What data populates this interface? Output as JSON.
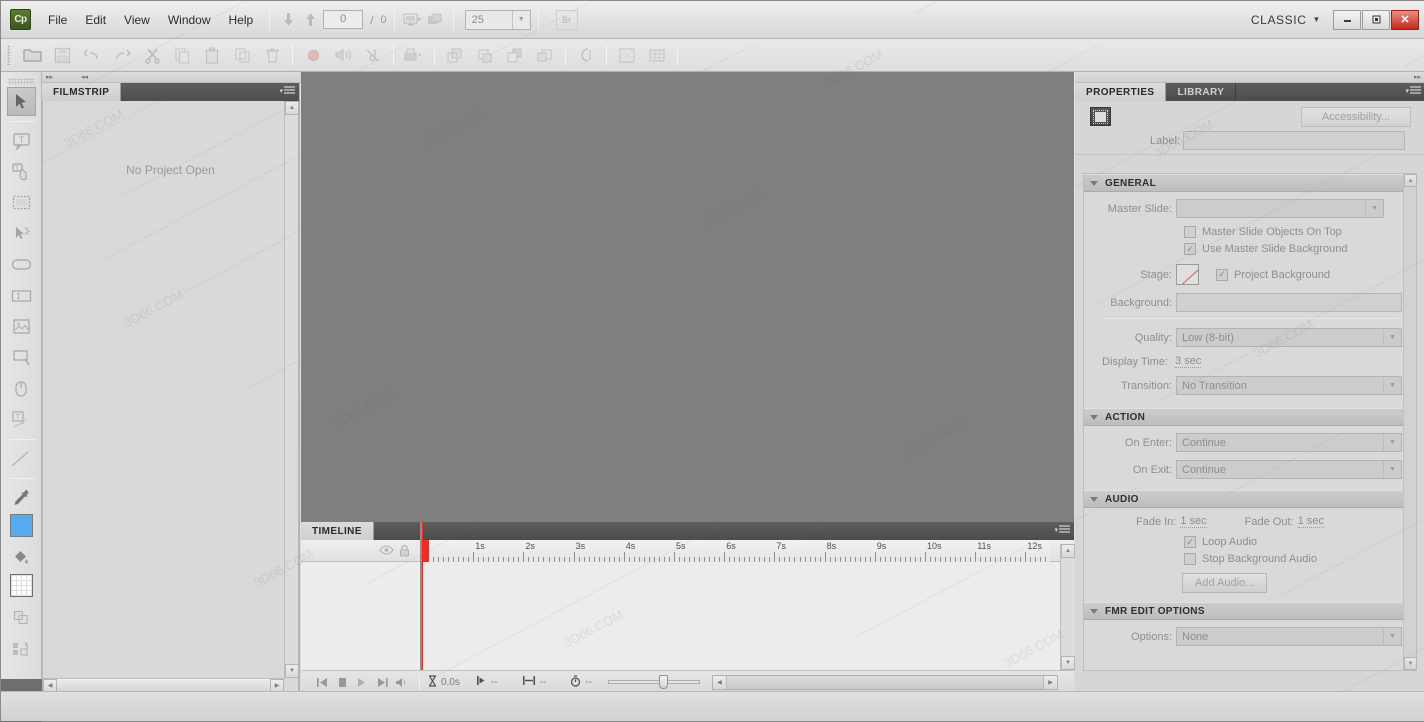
{
  "app": {
    "name": "Adobe Captivate",
    "logo_text": "Cp"
  },
  "menubar": {
    "items": [
      "File",
      "Edit",
      "View",
      "Window",
      "Help"
    ],
    "slide_nav": {
      "prev_icon": "arrow-down-icon",
      "next_icon": "arrow-up-icon",
      "current_slide": "0",
      "separator": "/",
      "total_slides": "0"
    },
    "preview_icon": "preview-monitor-icon",
    "publish_icon": "publish-icon",
    "zoom": {
      "value": "25",
      "caret": "▼"
    },
    "bridge_button": "Br",
    "workspace": {
      "label": "CLASSIC",
      "caret": "▼"
    },
    "window_controls": {
      "minimize": "—",
      "restore": "❐",
      "close": "✕"
    }
  },
  "toolbar": {
    "groups": [
      [
        "open-icon",
        "save-icon",
        "undo-icon",
        "redo-icon",
        "cut-icon",
        "copy-icon",
        "paste-icon",
        "duplicate-icon",
        "delete-icon"
      ],
      [
        "record-icon",
        "record-audio-icon",
        "remove-audio-icon"
      ],
      [
        "publish-settings-icon"
      ],
      [
        "bring-to-front-icon",
        "bring-forward-icon",
        "send-backward-icon",
        "send-to-back-icon"
      ],
      [
        "align-icon"
      ],
      [
        "preview-project-icon",
        "table-icon"
      ]
    ]
  },
  "tools": {
    "items": [
      {
        "name": "selection-tool",
        "selected": true
      },
      {
        "name": "text-caption-tool",
        "selected": false
      },
      {
        "name": "rollover-caption-tool",
        "selected": false
      },
      {
        "name": "highlight-box-tool",
        "selected": false
      },
      {
        "name": "click-box-tool",
        "selected": false
      },
      {
        "name": "button-tool",
        "selected": false
      },
      {
        "name": "text-entry-box-tool",
        "selected": false
      },
      {
        "name": "image-tool",
        "selected": false
      },
      {
        "name": "zoom-area-tool",
        "selected": false
      },
      {
        "name": "mouse-tool",
        "selected": false
      },
      {
        "name": "text-animation-tool",
        "selected": false
      },
      {
        "name": "line-tool",
        "selected": false
      },
      {
        "name": "eyedropper-tool",
        "selected": false
      },
      {
        "name": "fill-color-swatch",
        "selected": false,
        "color": "#55aaf0"
      },
      {
        "name": "paint-bucket-tool",
        "selected": false
      },
      {
        "name": "stroke-color-swatch",
        "selected": false,
        "color": "#ffffff"
      },
      {
        "name": "duplicate-object-tool",
        "selected": false
      },
      {
        "name": "reset-tool",
        "selected": false
      }
    ]
  },
  "filmstrip": {
    "tab_label": "FILMSTRIP",
    "empty_message": "No Project Open",
    "panel_menu_icon": "panel-menu-icon"
  },
  "stage": {
    "background_color": "#7f7f7f"
  },
  "timeline": {
    "tab_label": "TIMELINE",
    "eye_icon": "eye-icon",
    "lock_icon": "lock-icon",
    "ruler_labels": [
      "1s",
      "2s",
      "3s",
      "4s",
      "5s",
      "6s",
      "7s",
      "8s",
      "9s",
      "10s",
      "11s",
      "12s"
    ],
    "playhead_time": "0.0s",
    "transport": {
      "go_to_start": "go-to-start-icon",
      "stop": "stop-icon",
      "play": "play-icon",
      "go_to_end": "go-to-end-icon",
      "mute": "mute-icon"
    },
    "readouts": [
      {
        "icon": "hourglass-icon",
        "value": "0.0s"
      },
      {
        "icon": "start-marker-icon",
        "value": "--"
      },
      {
        "icon": "duration-marker-icon",
        "value": "--"
      },
      {
        "icon": "stopwatch-icon",
        "value": "--"
      }
    ],
    "zoom_slider": {
      "position_percent": 55
    }
  },
  "properties": {
    "tabs": [
      {
        "label": "PROPERTIES",
        "active": true
      },
      {
        "label": "LIBRARY",
        "active": false
      }
    ],
    "panel_menu_icon": "panel-menu-icon",
    "slide_type_icon": "slide-icon",
    "accessibility_button": "Accessibility...",
    "label_field": {
      "label": "Label:",
      "value": "",
      "placeholder": ""
    },
    "sections": [
      {
        "title": "GENERAL",
        "rows": {
          "master_slide": {
            "label": "Master Slide:",
            "value": ""
          },
          "master_slide_objects_on_top": {
            "label": "Master Slide Objects On Top",
            "checked": false
          },
          "use_master_slide_background": {
            "label": "Use Master Slide Background",
            "checked": true
          },
          "stage": {
            "label": "Stage:",
            "swatch": "transparent-swatch"
          },
          "project_background": {
            "label": "Project Background",
            "checked": true
          },
          "background": {
            "label": "Background:",
            "value": ""
          },
          "quality": {
            "label": "Quality:",
            "value": "Low (8-bit)"
          },
          "display_time": {
            "label": "Display Time:",
            "value": "3 sec"
          },
          "transition": {
            "label": "Transition:",
            "value": "No Transition"
          }
        }
      },
      {
        "title": "ACTION",
        "rows": {
          "on_enter": {
            "label": "On Enter:",
            "value": "Continue"
          },
          "on_exit": {
            "label": "On Exit:",
            "value": "Continue"
          }
        }
      },
      {
        "title": "AUDIO",
        "rows": {
          "fade_in": {
            "label": "Fade In:",
            "value": "1 sec"
          },
          "fade_out": {
            "label": "Fade Out:",
            "value": "1 sec"
          },
          "loop_audio": {
            "label": "Loop Audio",
            "checked": true
          },
          "stop_background_audio": {
            "label": "Stop Background Audio",
            "checked": false
          },
          "add_audio_button": "Add Audio..."
        }
      },
      {
        "title": "FMR EDIT OPTIONS",
        "rows": {
          "options": {
            "label": "Options:",
            "value": "None"
          }
        }
      }
    ]
  },
  "watermark": {
    "texts": [
      "3D66.COM",
      "3D66.COM",
      "3D66.COM",
      "3D66.COM",
      "3D66.COM",
      "3D66.COM"
    ]
  }
}
